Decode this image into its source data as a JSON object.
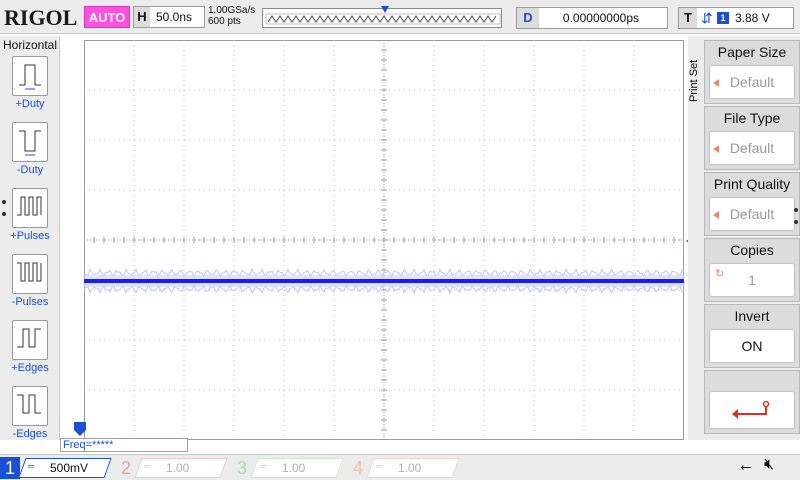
{
  "brand": "RIGOL",
  "status": {
    "mode": "AUTO",
    "mode_color": "#ff4fe0"
  },
  "horizontal": {
    "label": "H",
    "timebase": "50.0ns",
    "sample_rate": "1.00GSa/s",
    "mem_depth": "600 pts"
  },
  "delay": {
    "label": "D",
    "value": "0.00000000ps"
  },
  "trigger": {
    "label": "T",
    "channel": "1",
    "level": "3.88 V"
  },
  "left_menu": {
    "title": "Horizontal",
    "items": [
      {
        "label": "+Duty"
      },
      {
        "label": "-Duty"
      },
      {
        "label": "+Pulses"
      },
      {
        "label": "-Pulses"
      },
      {
        "label": "+Edges"
      },
      {
        "label": "-Edges"
      }
    ]
  },
  "right_menu": {
    "section": "Print Set",
    "items": [
      {
        "label": "Paper Size",
        "value": "Default"
      },
      {
        "label": "File Type",
        "value": "Default"
      },
      {
        "label": "Print Quality",
        "value": "Default"
      },
      {
        "label": "Copies",
        "value": "1"
      },
      {
        "label": "Invert",
        "value": "ON"
      },
      {
        "label": "",
        "value": ""
      }
    ]
  },
  "freq": {
    "label": "Freq=*****"
  },
  "channels": [
    {
      "num": "1",
      "scale": "500mV",
      "color": "#1a4fd6"
    },
    {
      "num": "2",
      "scale": "1.00 V",
      "color": "#e9a0a0"
    },
    {
      "num": "3",
      "scale": "1.00 V",
      "color": "#a8dca8"
    },
    {
      "num": "4",
      "scale": "1.00 V",
      "color": "#f0c0a0"
    }
  ],
  "trace_color": "#1a1aff",
  "grid_color": "#bdbdbd"
}
